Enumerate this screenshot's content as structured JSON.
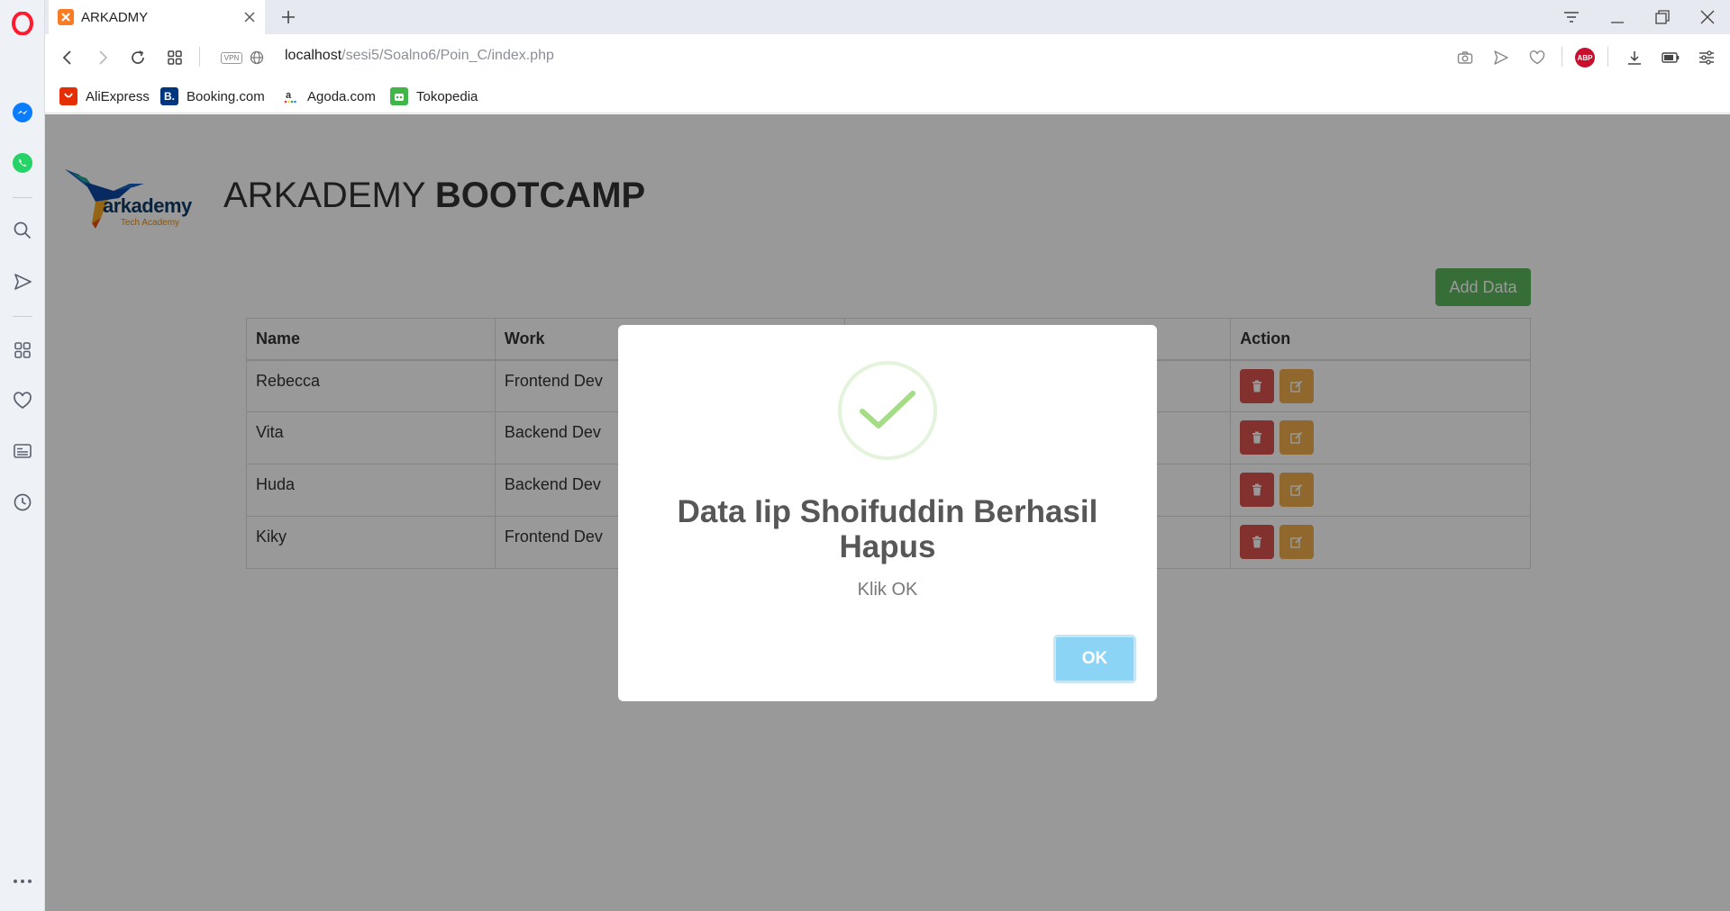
{
  "browser": {
    "tab_title": "ARKADMY",
    "url_host": "localhost",
    "url_path": "/sesi5/Soalno6/Poin_C/index.php",
    "bookmarks": [
      {
        "label": "AliExpress",
        "color": "#e62e04",
        "icon": "aliexpress-icon"
      },
      {
        "label": "Booking.com",
        "color": "#003580",
        "icon": "booking-icon"
      },
      {
        "label": "Agoda.com",
        "color": "#ffffff",
        "icon": "agoda-icon"
      },
      {
        "label": "Tokopedia",
        "color": "#42b549",
        "icon": "tokopedia-icon"
      }
    ],
    "abp_label": "ABP",
    "vpn_label": "VPN"
  },
  "page": {
    "heading_light": "ARKADEMY ",
    "heading_bold": "BOOTCAMP",
    "logo_text": "arkademy",
    "logo_subtext": "Tech Academy",
    "add_button": "Add Data",
    "table": {
      "headers": [
        "Name",
        "Work",
        "",
        "Action"
      ],
      "rows": [
        {
          "name": "Rebecca",
          "work": "Frontend Dev"
        },
        {
          "name": "Vita",
          "work": "Backend Dev"
        },
        {
          "name": "Huda",
          "work": "Backend Dev"
        },
        {
          "name": "Kiky",
          "work": "Frontend Dev"
        }
      ]
    }
  },
  "modal": {
    "title": "Data Iip Shoifuddin Berhasil Hapus",
    "text": "Klik OK",
    "ok_label": "OK"
  },
  "colors": {
    "success": "#5cb85c",
    "danger": "#d9534f",
    "warning": "#f0ad4e",
    "ok_button": "#8cd4f5",
    "opera_red": "#ff1b2d"
  }
}
